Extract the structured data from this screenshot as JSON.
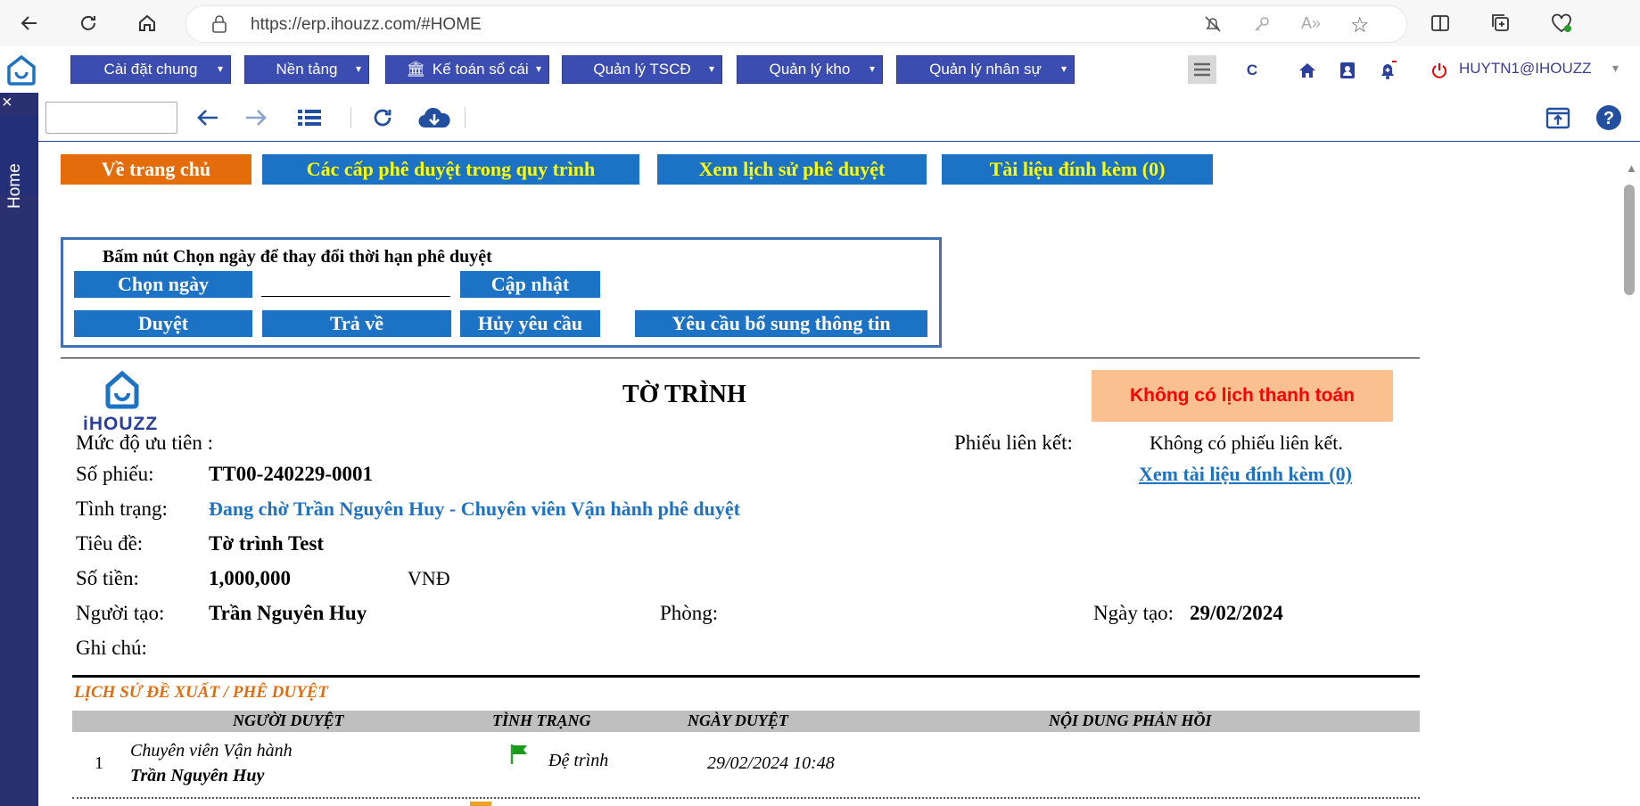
{
  "browser": {
    "url": "https://erp.ihouzz.com/#HOME"
  },
  "appnav": {
    "menus": [
      {
        "label": "Cài đặt chung"
      },
      {
        "label": "Nền tảng"
      },
      {
        "label": "Kế toán sổ cái"
      },
      {
        "label": "Quản lý TSCĐ"
      },
      {
        "label": "Quản lý kho"
      },
      {
        "label": "Quản lý nhân sự"
      }
    ],
    "c_label": "C",
    "user": "HUYTN1@IHOUZZ",
    "brand_color": "#3b4db0"
  },
  "rail": {
    "close": "×",
    "home": "Home"
  },
  "top_buttons": {
    "home": "Về trang chủ",
    "levels": "Các cấp phê duyệt trong quy trình",
    "history": "Xem lịch sử phê duyệt",
    "attachments": "Tài liệu đính kèm (0)"
  },
  "approve_box": {
    "hint": "Bấm nút Chọn ngày để thay đổi thời hạn phê duyệt",
    "choose_date": "Chọn ngày",
    "update": "Cập nhật",
    "approve": "Duyệt",
    "return": "Trả về",
    "cancel": "Hủy yêu cầu",
    "request_info": "Yêu cầu bổ sung thông tin"
  },
  "doc": {
    "logo_text": "iHOUZZ",
    "title": "TỜ TRÌNH",
    "no_payment": "Không có lịch thanh toán",
    "priority_label": "Mức độ ưu tiên :",
    "linked_label": "Phiếu liên kết:",
    "linked_value": "Không có phiếu liên kết.",
    "number_label": "Số phiếu:",
    "number_value": "TT00-240229-0001",
    "attach_link": "Xem tài liệu đính kèm (0)",
    "status_label": "Tình trạng:",
    "status_value": "Đang chờ Trần Nguyên Huy - Chuyên viên Vận hành  phê duyệt",
    "subject_label": "Tiêu đề:",
    "subject_value": "Tờ trình Test",
    "amount_label": "Số tiền:",
    "amount_value": "1,000,000",
    "currency": "VNĐ",
    "creator_label": "Người tạo:",
    "creator_value": "Trần Nguyên Huy",
    "dept_label": "Phòng:",
    "created_label": "Ngày tạo:",
    "created_value": "29/02/2024",
    "note_label": "Ghi chú:"
  },
  "history": {
    "title": "LỊCH SỬ ĐỀ XUẤT / PHÊ DUYỆT",
    "columns": [
      "NGƯỜI DUYỆT",
      "TÌNH TRẠNG",
      "NGÀY DUYỆT",
      "NỘI DUNG PHẢN HỒI"
    ],
    "rows": [
      {
        "index": "1",
        "role": "Chuyên viên Vận hành",
        "name": "Trần Nguyên Huy",
        "status": "Đệ trình",
        "date": "29/02/2024 10:48",
        "feedback": ""
      }
    ]
  },
  "colors": {
    "orange_btn": "#e46c0a",
    "blue_btn": "#1c72c4",
    "yellow_text": "#ffff00",
    "rail": "#2a3070"
  }
}
